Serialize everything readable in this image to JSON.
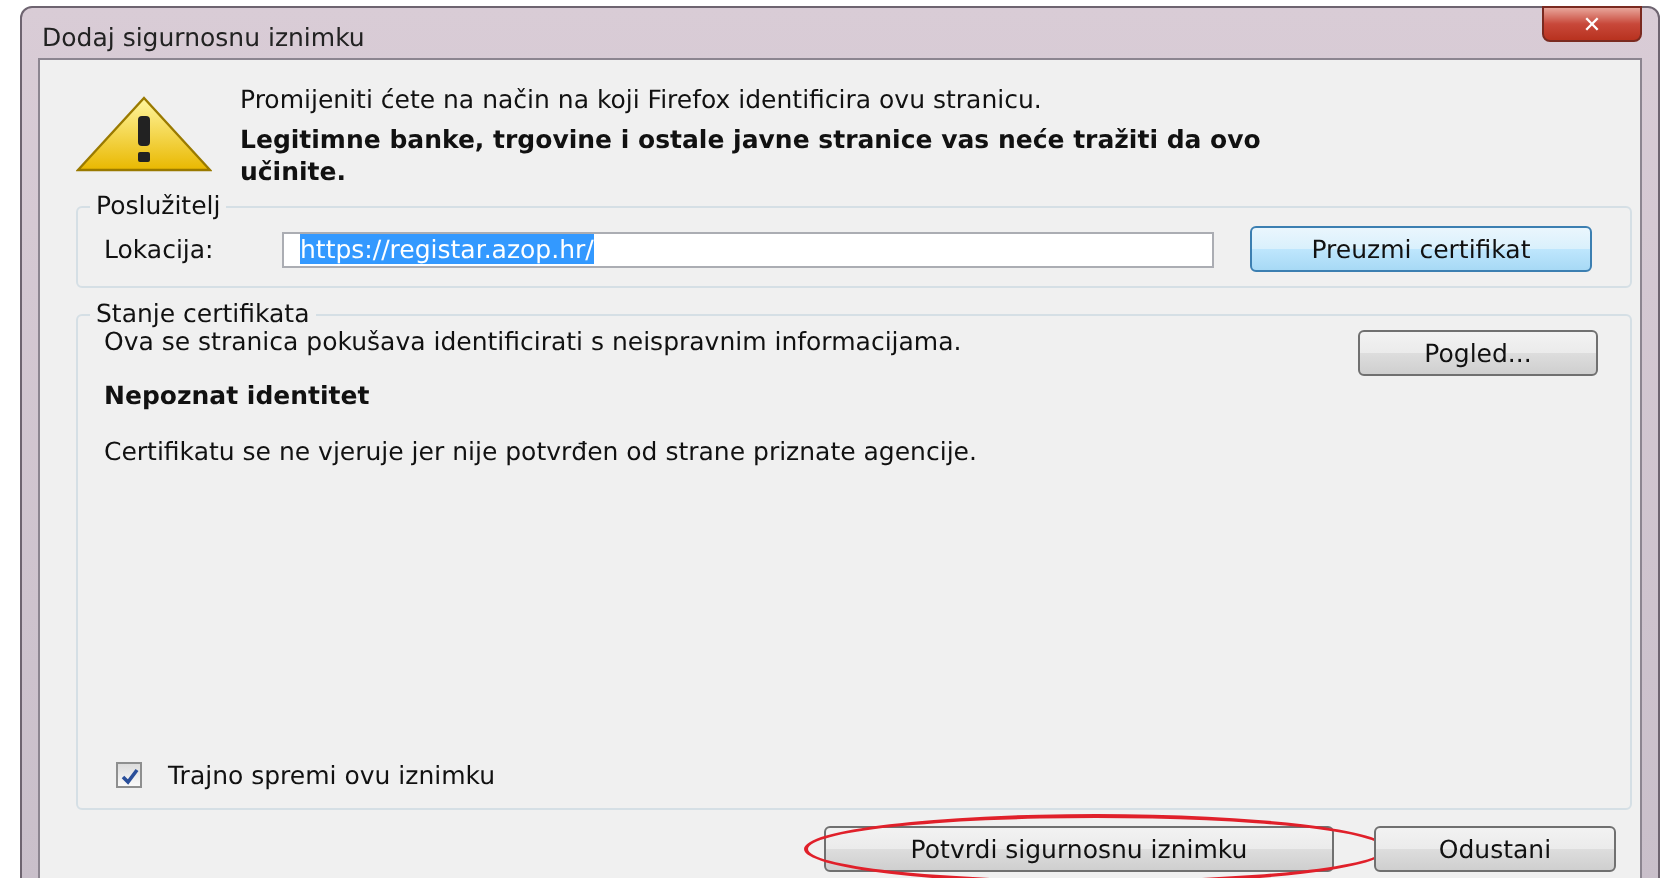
{
  "window": {
    "title": "Dodaj sigurnosnu iznimku",
    "close_symbol": "✕"
  },
  "warning": {
    "lines": [
      {
        "text": "Promijeniti ćete na način na koji Firefox identificira ovu stranicu.",
        "bold": false
      },
      {
        "text": "Legitimne banke, trgovine i ostale javne stranice vas neće tražiti da ovo učinite.",
        "bold": true
      }
    ]
  },
  "server": {
    "legend": "Poslužitelj",
    "label": "Lokacija:",
    "value": "https://registar.azop.hr/",
    "value_selected": true,
    "button": "Preuzmi certifikat"
  },
  "certificate_status": {
    "legend": "Stanje certifikata",
    "message": "Ova se stranica pokušava identificirati s neispravnim informacijama.",
    "button": "Pogled...",
    "heading": "Nepoznat identitet",
    "detail": "Certifikatu se ne vjeruje jer nije potvrđen od strane priznate agencije."
  },
  "permanent": {
    "label": "Trajno spremi ovu iznimku",
    "checked": true
  },
  "buttons": [
    {
      "label": "Potvrdi sigurnosnu iznimku",
      "highlighted": true
    },
    {
      "label": "Odustani",
      "highlighted": false
    }
  ]
}
